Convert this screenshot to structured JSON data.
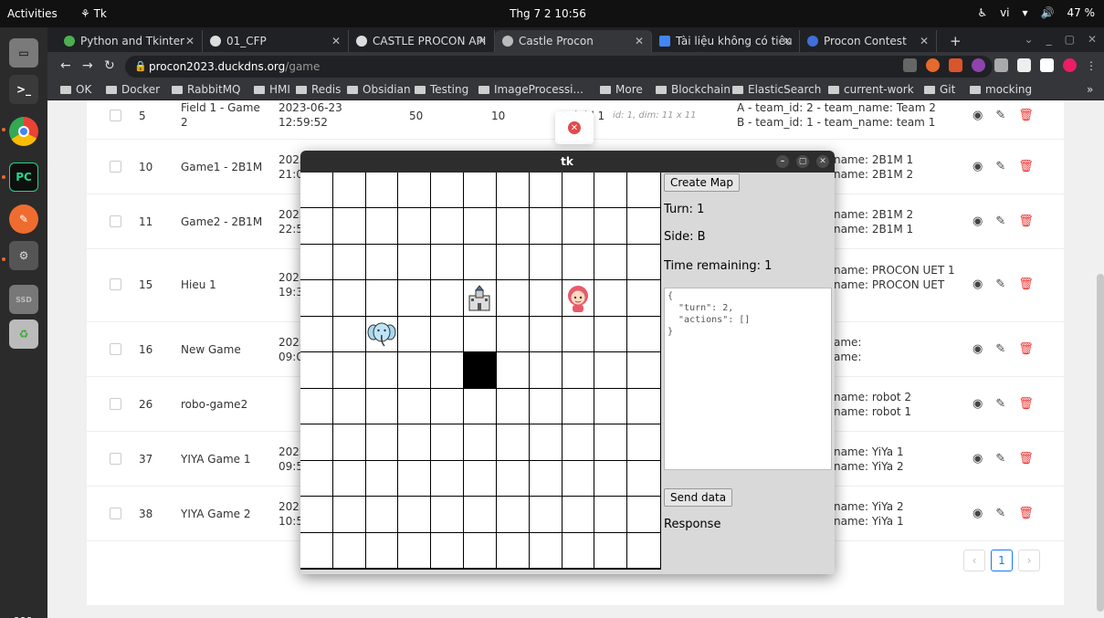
{
  "topbar": {
    "activities": "Activities",
    "app": "Tk",
    "clock": "Thg 7 2  10:56",
    "lang": "vi",
    "battery": "47 %"
  },
  "browser": {
    "tabs": [
      {
        "label": "Python and Tkinter",
        "color": "#4caf50"
      },
      {
        "label": "01_CFP",
        "color": "#dddddd"
      },
      {
        "label": "CASTLE PROCON API",
        "color": "#dddddd"
      },
      {
        "label": "Castle Procon",
        "color": "#bbbbbb"
      },
      {
        "label": "Tài liệu không có tiêu",
        "color": "#4285f4"
      },
      {
        "label": "Procon Contest",
        "color": "#3f6fd8"
      }
    ],
    "url_host": "procon2023.duckdns.org",
    "url_path": "/game",
    "bookmarks": [
      "OK",
      "Docker",
      "RabbitMQ",
      "HMI",
      "Redis",
      "Obsidian",
      "Testing",
      "ImageProcessi...",
      "More",
      "Blockchain",
      "ElasticSearch",
      "current-work",
      "Git",
      "mocking"
    ]
  },
  "table": {
    "rows": [
      {
        "id": "5",
        "name": "Field 1 - Game\n2",
        "date": "2023-06-23\n12:59:52",
        "c4": "50",
        "c5": "10",
        "field": "Field 1",
        "field_meta": "id: 1, dim: 11 x 11",
        "teams": "A - team_id: 2 - team_name: Team 2\nB - team_id: 1 - team_name: team 1"
      },
      {
        "id": "10",
        "name": "Game1 - 2B1M",
        "date": "2023\n21:0",
        "teams": "name: 2B1M 1\nname: 2B1M 2"
      },
      {
        "id": "11",
        "name": "Game2 - 2B1M",
        "date": "2023\n22:5",
        "teams": "name: 2B1M 2\nname: 2B1M 1"
      },
      {
        "id": "15",
        "name": "Hieu 1",
        "date": "2023\n19:3",
        "teams": "name: PROCON UET 1\nname: PROCON UET"
      },
      {
        "id": "16",
        "name": "New Game",
        "date": "2023\n09:0",
        "teams": "ame:\name:"
      },
      {
        "id": "26",
        "name": "robo-game2",
        "date": "",
        "teams": "name: robot 2\nname: robot 1"
      },
      {
        "id": "37",
        "name": "YIYA Game 1",
        "date": "2023\n09:5",
        "teams": "name: YiYa 1\nname: YiYa 2"
      },
      {
        "id": "38",
        "name": "YIYA Game 2",
        "date": "2023\n10:5",
        "teams": "name: YiYa 2\nname: YiYa 1"
      }
    ],
    "page": "1"
  },
  "tk": {
    "title": "tk",
    "create_map": "Create Map",
    "turn": "Turn: 1",
    "side": "Side: B",
    "time": "Time remaining: 1",
    "json": "{\n  \"turn\": 2,\n  \"actions\": []\n}",
    "send": "Send data",
    "response": "Response",
    "grid": {
      "rows": 11,
      "cols": 11,
      "castle": [
        3,
        5
      ],
      "girl": [
        3,
        8
      ],
      "elephant": [
        4,
        2
      ],
      "blocks": [
        [
          5,
          5
        ]
      ]
    }
  }
}
